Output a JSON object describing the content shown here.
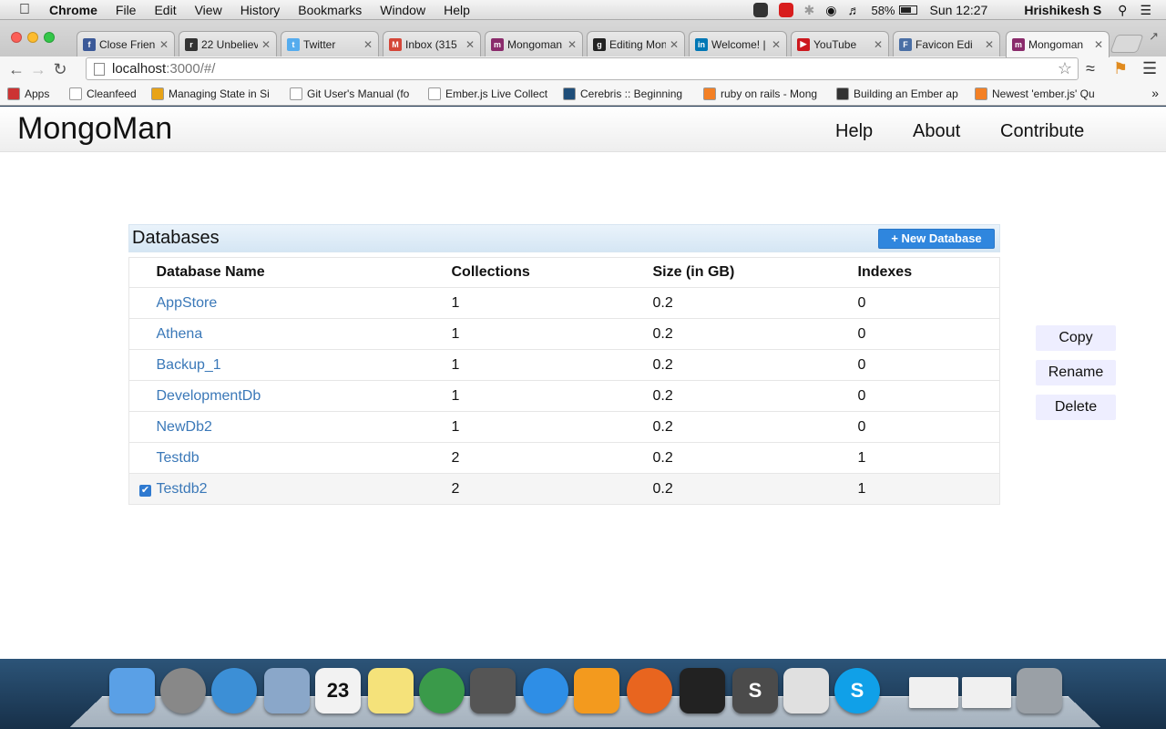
{
  "menubar": {
    "app": "Chrome",
    "items": [
      "File",
      "Edit",
      "View",
      "History",
      "Bookmarks",
      "Window",
      "Help"
    ],
    "battery": "58%",
    "clock": "Sun 12:27",
    "user": "Hrishikesh S"
  },
  "tabs": [
    {
      "label": "Close Frien",
      "icon": "facebook-icon",
      "color": "#3b5998",
      "glyph": "f"
    },
    {
      "label": "22 Unbeliev",
      "icon": "reddit-icon",
      "color": "#333333",
      "glyph": "r"
    },
    {
      "label": "Twitter",
      "icon": "twitter-icon",
      "color": "#55acee",
      "glyph": "t"
    },
    {
      "label": "Inbox (315",
      "icon": "gmail-icon",
      "color": "#d44638",
      "glyph": "M"
    },
    {
      "label": "Mongoman",
      "icon": "mongoman-icon",
      "color": "#8a2b6b",
      "glyph": "m"
    },
    {
      "label": "Editing Mon",
      "icon": "github-icon",
      "color": "#222222",
      "glyph": "g"
    },
    {
      "label": "Welcome! |",
      "icon": "linkedin-icon",
      "color": "#0077b5",
      "glyph": "in"
    },
    {
      "label": "YouTube",
      "icon": "youtube-icon",
      "color": "#cc181e",
      "glyph": "▶"
    },
    {
      "label": "Favicon Edi",
      "icon": "favicon-editor-icon",
      "color": "#4a6fa5",
      "glyph": "F"
    },
    {
      "label": "Mongoman",
      "icon": "mongoman-icon",
      "color": "#8a2b6b",
      "glyph": "m",
      "active": true
    }
  ],
  "address": {
    "host": "localhost",
    "path": ":3000/#/"
  },
  "bookmarks": [
    {
      "label": "Apps",
      "color": "#c33"
    },
    {
      "label": "Cleanfeed",
      "color": "#ffffff"
    },
    {
      "label": "Managing State in Si",
      "color": "#e8a317"
    },
    {
      "label": "Git User's Manual (fo",
      "color": "#ffffff"
    },
    {
      "label": "Ember.js Live Collect",
      "color": "#ffffff"
    },
    {
      "label": "Cerebris :: Beginning",
      "color": "#1f4e79"
    },
    {
      "label": "ruby on rails - Mong",
      "color": "#f48024"
    },
    {
      "label": "Building an Ember ap",
      "color": "#333333"
    },
    {
      "label": "Newest 'ember.js' Qu",
      "color": "#f48024"
    }
  ],
  "app": {
    "brand": "MongoMan",
    "nav": [
      "Help",
      "About",
      "Contribute"
    ]
  },
  "panel": {
    "title": "Databases",
    "new_button": "+ New Database",
    "columns": [
      "Database Name",
      "Collections",
      "Size (in GB)",
      "Indexes"
    ],
    "rows": [
      {
        "name": "AppStore",
        "collections": "1",
        "size": "0.2",
        "indexes": "0",
        "checked": false
      },
      {
        "name": "Athena",
        "collections": "1",
        "size": "0.2",
        "indexes": "0",
        "checked": false
      },
      {
        "name": "Backup_1",
        "collections": "1",
        "size": "0.2",
        "indexes": "0",
        "checked": false
      },
      {
        "name": "DevelopmentDb",
        "collections": "1",
        "size": "0.2",
        "indexes": "0",
        "checked": false
      },
      {
        "name": "NewDb2",
        "collections": "1",
        "size": "0.2",
        "indexes": "0",
        "checked": false
      },
      {
        "name": "Testdb",
        "collections": "2",
        "size": "0.2",
        "indexes": "1",
        "checked": false
      },
      {
        "name": "Testdb2",
        "collections": "2",
        "size": "0.2",
        "indexes": "1",
        "checked": true
      }
    ]
  },
  "actions": [
    "Copy",
    "Rename",
    "Delete"
  ],
  "dock": [
    {
      "name": "finder-icon",
      "color": "#5aa0e6"
    },
    {
      "name": "launchpad-icon",
      "color": "#888888",
      "round": true
    },
    {
      "name": "safari-icon",
      "color": "#3c8fd6",
      "round": true
    },
    {
      "name": "mail-icon",
      "color": "#8aa7c9"
    },
    {
      "name": "calendar-icon",
      "color": "#f2f2f2",
      "text": "23"
    },
    {
      "name": "notes-icon",
      "color": "#f5e27a"
    },
    {
      "name": "chrome-icon",
      "color": "#3a9a4a",
      "round": true
    },
    {
      "name": "facetime-icon",
      "color": "#555555"
    },
    {
      "name": "itunes-icon",
      "color": "#2e8ee6",
      "round": true
    },
    {
      "name": "ibooks-icon",
      "color": "#f39a1e"
    },
    {
      "name": "firefox-icon",
      "color": "#e8651f",
      "round": true
    },
    {
      "name": "terminal-icon",
      "color": "#222222"
    },
    {
      "name": "sublime-text-icon",
      "color": "#4b4b4b",
      "text": "S"
    },
    {
      "name": "opera-icon",
      "color": "#e0e0e0"
    },
    {
      "name": "skype-icon",
      "color": "#10a0e8",
      "round": true,
      "text": "S"
    },
    {
      "name": "window-preview-icon",
      "color": "#f0f0f0"
    },
    {
      "name": "chrome-window-preview-icon",
      "color": "#f0f0f0"
    },
    {
      "name": "trash-icon",
      "color": "#9aa0a6"
    }
  ]
}
